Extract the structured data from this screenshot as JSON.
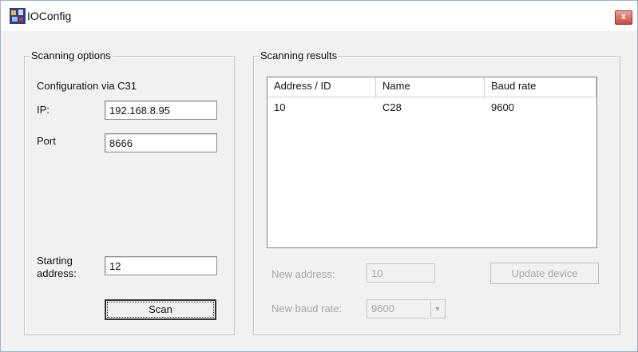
{
  "window": {
    "title": "IOConfig",
    "close_label": "x"
  },
  "scan_options": {
    "legend": "Scanning options",
    "config_label": "Configuration via C31",
    "ip_label": "IP:",
    "ip_value": "192.168.8.95",
    "port_label": "Port",
    "port_value": "8666",
    "start_label": "Starting address:",
    "start_value": "12",
    "scan_button": "Scan"
  },
  "scan_results": {
    "legend": "Scanning results",
    "columns": [
      "Address / ID",
      "Name",
      "Baud rate"
    ],
    "rows": [
      {
        "address": "10",
        "name": "C28",
        "baud": "9600"
      }
    ],
    "new_address_label": "New address:",
    "new_address_value": "10",
    "new_baud_label": "New baud rate:",
    "new_baud_value": "9600",
    "update_button": "Update device"
  }
}
